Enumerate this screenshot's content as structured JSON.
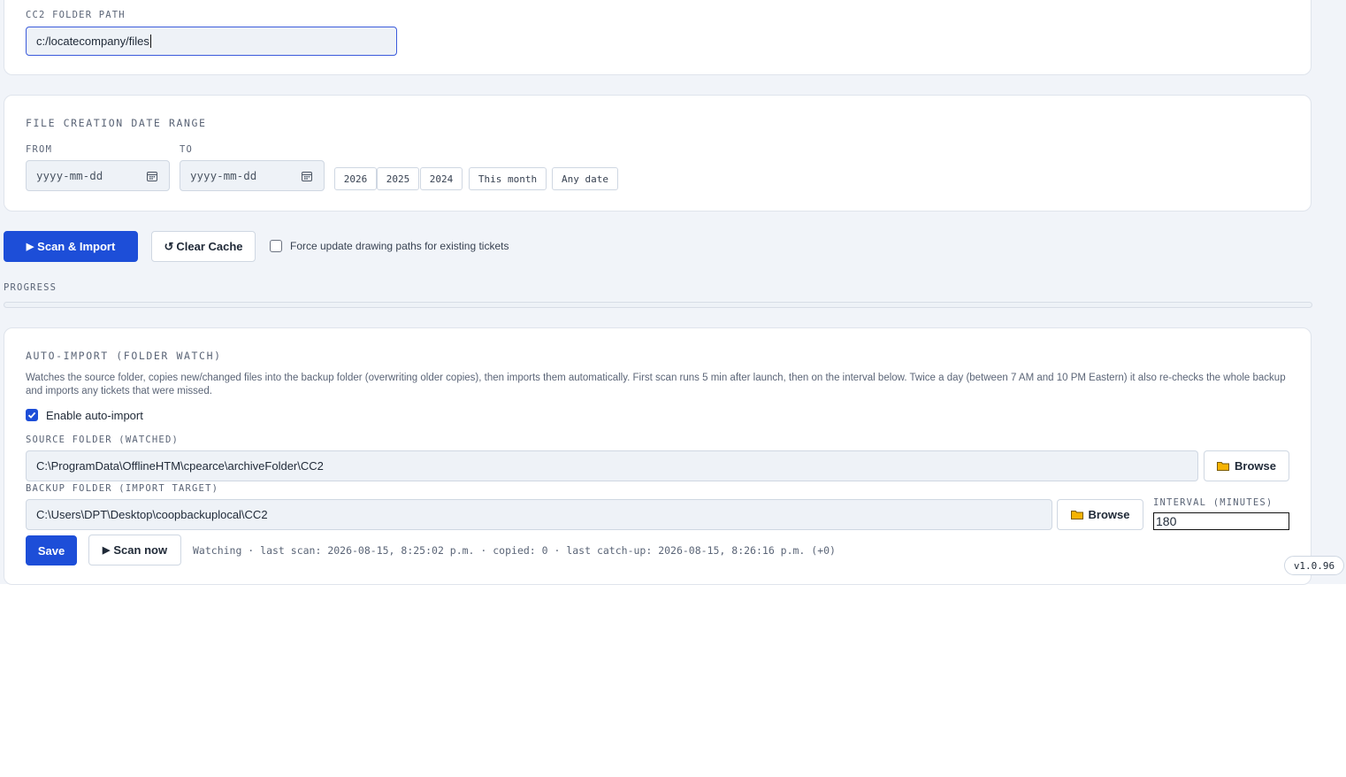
{
  "cc2_path": {
    "label": "CC2 FOLDER PATH",
    "value": "c:/locatecompany/files"
  },
  "date_range": {
    "title": "FILE CREATION DATE RANGE",
    "from_label": "FROM",
    "to_label": "TO",
    "from_placeholder": "yyyy-mm-dd",
    "to_placeholder": "yyyy-mm-dd",
    "presets": [
      "2026",
      "2025",
      "2024",
      "This month",
      "Any date"
    ]
  },
  "actions": {
    "scan_import_label": "Scan & Import",
    "clear_cache_label": "Clear Cache",
    "force_update_label": "Force update drawing paths for existing tickets",
    "force_update_checked": false
  },
  "progress": {
    "label": "PROGRESS",
    "value": 0
  },
  "auto_import": {
    "title": "AUTO-IMPORT (FOLDER WATCH)",
    "description": "Watches the source folder, copies new/changed files into the backup folder (overwriting older copies), then imports them automatically. First scan runs 5 min after launch, then on the interval below. Twice a day (between 7 AM and 10 PM Eastern) it also re-checks the whole backup and imports any tickets that were missed.",
    "enable_label": "Enable auto-import",
    "enabled": true,
    "source_label": "SOURCE FOLDER (WATCHED)",
    "source_value": "C:\\ProgramData\\OfflineHTM\\cpearce\\archiveFolder\\CC2",
    "backup_label": "BACKUP FOLDER (IMPORT TARGET)",
    "backup_value": "C:\\Users\\DPT\\Desktop\\coopbackuplocal\\CC2",
    "browse_label": "Browse",
    "interval_label": "INTERVAL (MINUTES)",
    "interval_value": "180",
    "save_label": "Save",
    "scan_now_label": "Scan now",
    "status_text": "Watching · last scan: 2026-08-15, 8:25:02 p.m. · copied: 0 · last catch-up: 2026-08-15, 8:26:16 p.m. (+0)"
  },
  "version": "v1.0.96",
  "colors": {
    "primary": "#1d4ed8",
    "page_background": "#f1f4f9",
    "field_background": "#eef2f7",
    "folder_icon": "#f5b301"
  },
  "icons": {
    "scan_import": "play-icon",
    "clear_cache": "refresh-icon",
    "calendar": "calendar-icon",
    "browse": "folder-icon",
    "scan_now": "play-icon"
  }
}
